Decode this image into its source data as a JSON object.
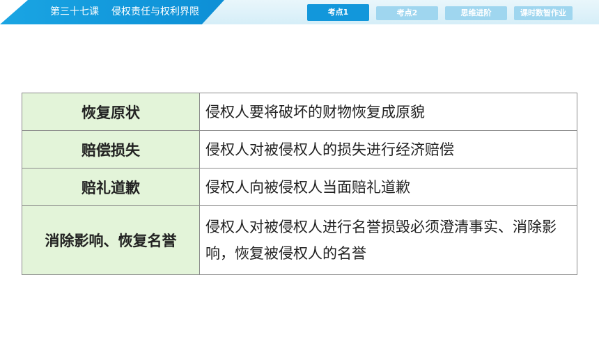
{
  "header": {
    "lesson_number": "第三十七课",
    "lesson_title": "侵权责任与权利界限",
    "tabs": [
      {
        "label": "考点1",
        "active": true
      },
      {
        "label": "考点2",
        "active": false
      },
      {
        "label": "思维进阶",
        "active": false
      },
      {
        "label": "课时数智作业",
        "active": false
      }
    ]
  },
  "table": {
    "rows": [
      {
        "term": "恢复原状",
        "desc": "侵权人要将破坏的财物恢复成原貌"
      },
      {
        "term": "赔偿损失",
        "desc": "侵权人对被侵权人的损失进行经济赔偿"
      },
      {
        "term": "赔礼道歉",
        "desc": "侵权人向被侵权人当面赔礼道歉"
      },
      {
        "term": "消除影响、恢复名誉",
        "desc": "侵权人对被侵权人进行名誉损毁必须澄清事实、消除影响，恢复被侵权人的名誉"
      }
    ]
  },
  "colors": {
    "header_blue": "#1297db",
    "tab_inactive": "#9fd6ef",
    "term_cell_bg": "#e3f4d9"
  }
}
